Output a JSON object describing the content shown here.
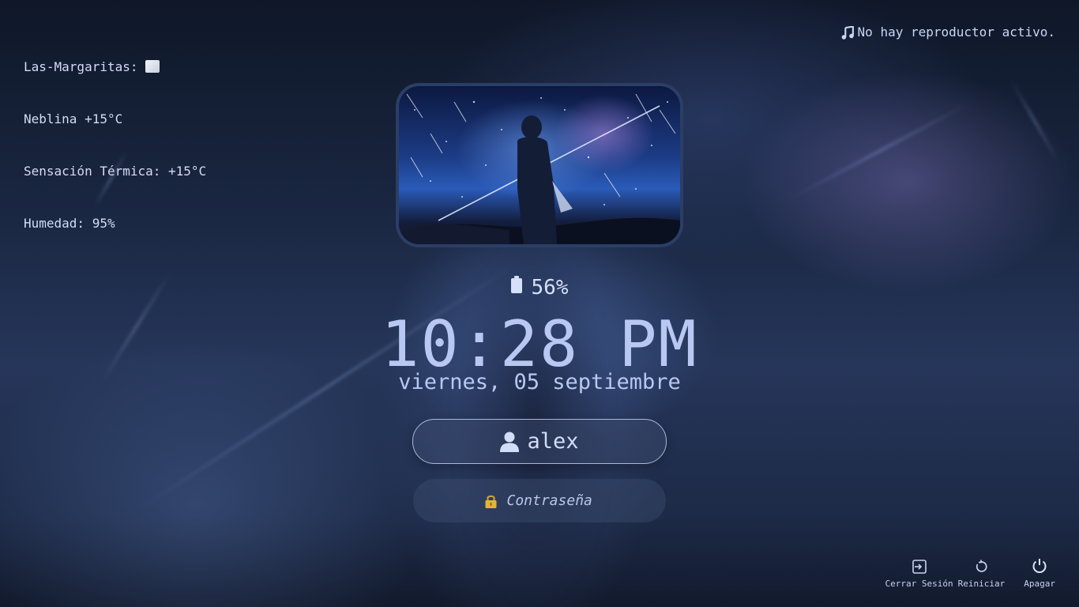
{
  "weather": {
    "location": "Las-Margaritas:",
    "condition": "Neblina +15°C",
    "feels_like": "Sensación Térmica: +15°C",
    "humidity": "Humedad: 95%"
  },
  "media": {
    "status": "No hay reproductor activo.",
    "icon": "music-note-icon"
  },
  "battery": {
    "percent_label": "56%",
    "level": 0.56,
    "icon": "battery-icon"
  },
  "clock": {
    "time": "10:28 PM",
    "date": "viernes, 05 septiembre"
  },
  "login": {
    "username": "alex",
    "user_icon": "user-icon",
    "password_placeholder": "Contraseña",
    "lock_icon": "lock-icon"
  },
  "power": {
    "logout_label": "Cerrar Sesión",
    "restart_label": "Reiniciar",
    "shutdown_label": "Apagar"
  },
  "colors": {
    "accent": "#b8c8f2",
    "frame_border": "#2b3e66",
    "background_dark": "#121a2c"
  }
}
